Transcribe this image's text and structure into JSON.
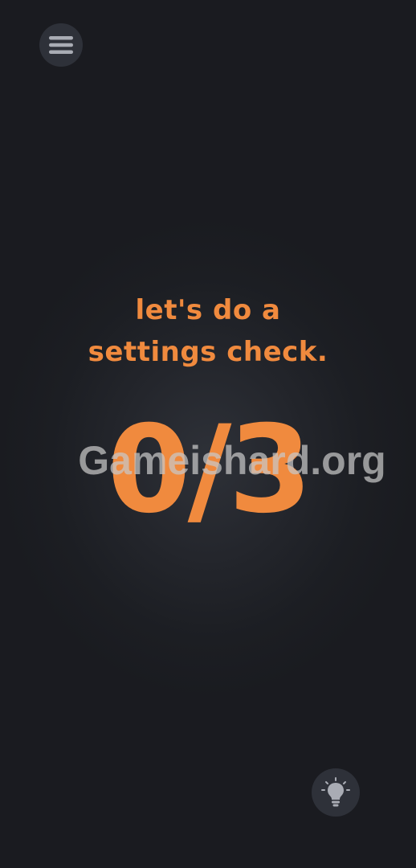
{
  "menu": {
    "icon": "hamburger-menu-icon"
  },
  "prompt": {
    "line1": "let's do a",
    "line2": "settings check."
  },
  "progress": {
    "text": "0/3",
    "completed": 0,
    "total": 3
  },
  "watermark": {
    "text": "Gameishard.org"
  },
  "hint": {
    "icon": "lightbulb-icon"
  },
  "colors": {
    "accent": "#f08a3e",
    "background": "#1c1e23",
    "button_bg": "#2e3139",
    "icon": "#a9acb4"
  }
}
